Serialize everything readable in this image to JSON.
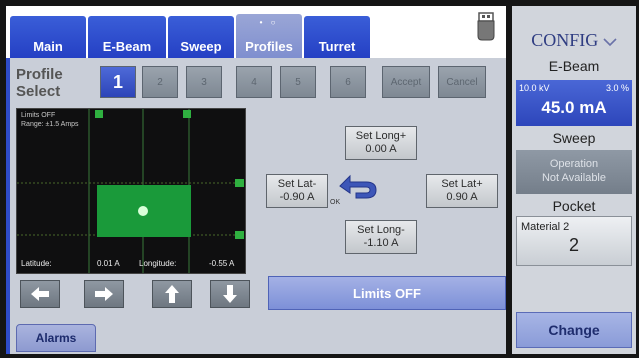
{
  "tabs": [
    {
      "label": "Main"
    },
    {
      "label": "E-Beam"
    },
    {
      "label": "Sweep"
    },
    {
      "label": "Profiles",
      "active": true
    },
    {
      "label": "Turret"
    }
  ],
  "tab_indicator": "• ○",
  "profile": {
    "label_line1": "Profile",
    "label_line2": "Select",
    "buttons": [
      "1",
      "2",
      "3",
      "4",
      "5",
      "6"
    ],
    "selected": "1",
    "accept_label": "Accept",
    "cancel_label": "Cancel"
  },
  "graph": {
    "limits_text": "Limits OFF",
    "range_text": "Range: ±1.5 Amps",
    "latitude_label": "Latitude:",
    "latitude_value": "0.01 A",
    "longitude_label": "Longitude:",
    "longitude_value": "-0.55 A"
  },
  "set_buttons": {
    "long_plus": {
      "label": "Set Long+",
      "value": "0.00 A"
    },
    "lat_minus": {
      "label": "Set Lat-",
      "value": "-0.90 A"
    },
    "lat_plus": {
      "label": "Set Lat+",
      "value": "0.90 A"
    },
    "long_minus": {
      "label": "Set Long-",
      "value": "-1.10 A"
    },
    "ok_label": "OK"
  },
  "arrows": [
    "arrow-left-icon",
    "arrow-right-icon",
    "arrow-up-icon",
    "arrow-down-icon"
  ],
  "limits_button_label": "Limits OFF",
  "alarms_label": "Alarms",
  "config": {
    "title": "CONFIG",
    "ebeam_heading": "E-Beam",
    "ebeam_kv": "10.0 kV",
    "ebeam_percent": "3.0 %",
    "ebeam_current": "45.0 mA",
    "sweep_heading": "Sweep",
    "sweep_line1": "Operation",
    "sweep_line2": "Not Available",
    "pocket_heading": "Pocket",
    "pocket_material": "Material 2",
    "pocket_number": "2",
    "change_label": "Change"
  },
  "colors": {
    "tab_blue": "#2f4cc9",
    "graph_green": "#1a9a3a",
    "marker_green": "#3fd04a"
  }
}
